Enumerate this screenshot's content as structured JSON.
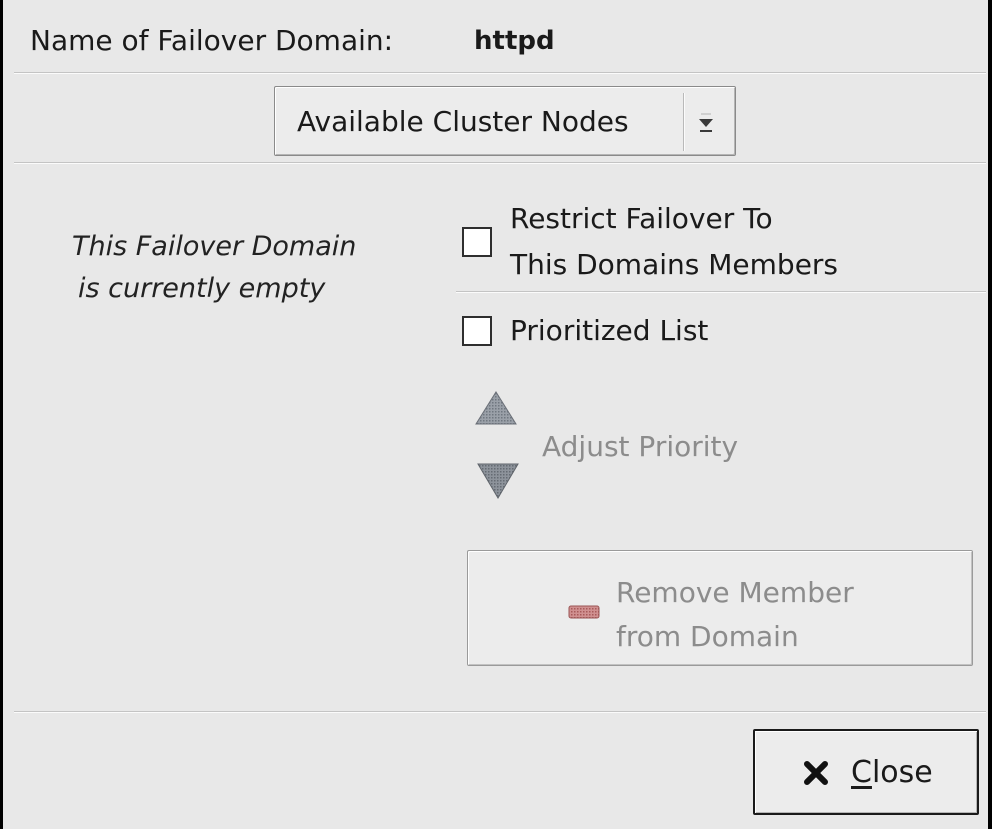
{
  "header": {
    "name_label": "Name of Failover Domain:",
    "name_value": "httpd"
  },
  "nodes_dropdown": {
    "selected": "Available Cluster Nodes",
    "icon": "dropdown-arrow-icon"
  },
  "members": {
    "empty_line1": "This Failover Domain",
    "empty_line2": "is currently empty"
  },
  "options": {
    "restrict": {
      "label_line1": "Restrict Failover To",
      "label_line2": "This Domains Members",
      "checked": false
    },
    "prioritized": {
      "label": "Prioritized List",
      "checked": false
    }
  },
  "priority": {
    "label": "Adjust Priority",
    "up_icon": "priority-up-icon",
    "down_icon": "priority-down-icon",
    "enabled": false
  },
  "remove_button": {
    "line1": "Remove Member",
    "line2": "from Domain",
    "icon": "remove-icon",
    "enabled": false
  },
  "close_button": {
    "mnemonic": "C",
    "rest": "lose",
    "icon": "close-icon"
  },
  "colors": {
    "background": "#e8e8e8",
    "disabled_text": "#8c8c8c",
    "remove_icon": "#c07878"
  }
}
